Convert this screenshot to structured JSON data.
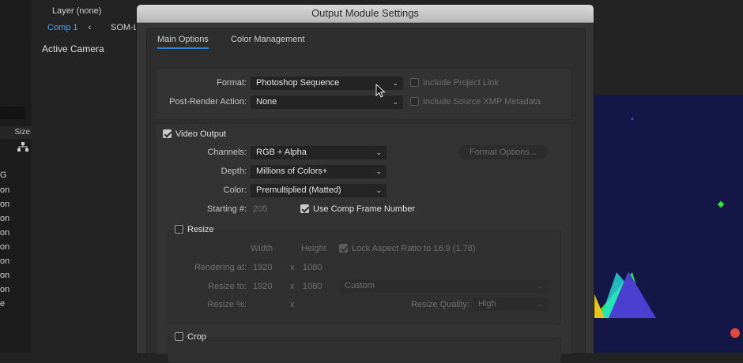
{
  "app": {
    "layer_label": "Layer (none)",
    "comp_tab": "Comp 1",
    "comp_tab_next": "SOM-L",
    "viewer_label": "Active Camera",
    "left_panel": {
      "col_header": "Size",
      "rows": [
        "G",
        "on",
        "on",
        "on",
        "on",
        "on",
        "on",
        "on",
        "on",
        "e"
      ]
    }
  },
  "dialog": {
    "title": "Output Module Settings",
    "tabs": [
      "Main Options",
      "Color Management"
    ],
    "format": {
      "label": "Format:",
      "value": "Photoshop Sequence",
      "include_project_link": "Include Project Link",
      "include_project_link_checked": false
    },
    "post_render": {
      "label": "Post-Render Action:",
      "value": "None",
      "include_xmp": "Include Source XMP Metadata",
      "include_xmp_checked": false
    },
    "video_output": {
      "label": "Video Output",
      "checked": true,
      "channels_label": "Channels:",
      "channels_value": "RGB + Alpha",
      "depth_label": "Depth:",
      "depth_value": "Millions of Colors+",
      "color_label": "Color:",
      "color_value": "Premultiplied (Matted)",
      "starting_label": "Starting #:",
      "starting_value": "205",
      "use_comp_frame": "Use Comp Frame Number",
      "use_comp_frame_checked": true,
      "format_options_button": "Format Options..."
    },
    "resize": {
      "label": "Resize",
      "checked": false,
      "width_header": "Width",
      "height_header": "Height",
      "lock_aspect": "Lock Aspect Ratio to 16:9 (1.78)",
      "rendering_at_label": "Rendering at:",
      "rendering_w": "1920",
      "rendering_h": "1080",
      "resize_to_label": "Resize to:",
      "resize_w": "1920",
      "resize_h": "1080",
      "preset_value": "Custom",
      "resize_pct_label": "Resize %:",
      "x": "x",
      "quality_label": "Resize Quality:",
      "quality_value": "High"
    },
    "crop": {
      "label": "Crop",
      "checked": false
    }
  },
  "colors": {
    "accent": "#2f7fd6",
    "comp_tab": "#4ea3f5",
    "viewer_bg": "#141646"
  },
  "icons": [
    "network-icon",
    "chevron-down-icon",
    "mouse-cursor-icon"
  ]
}
